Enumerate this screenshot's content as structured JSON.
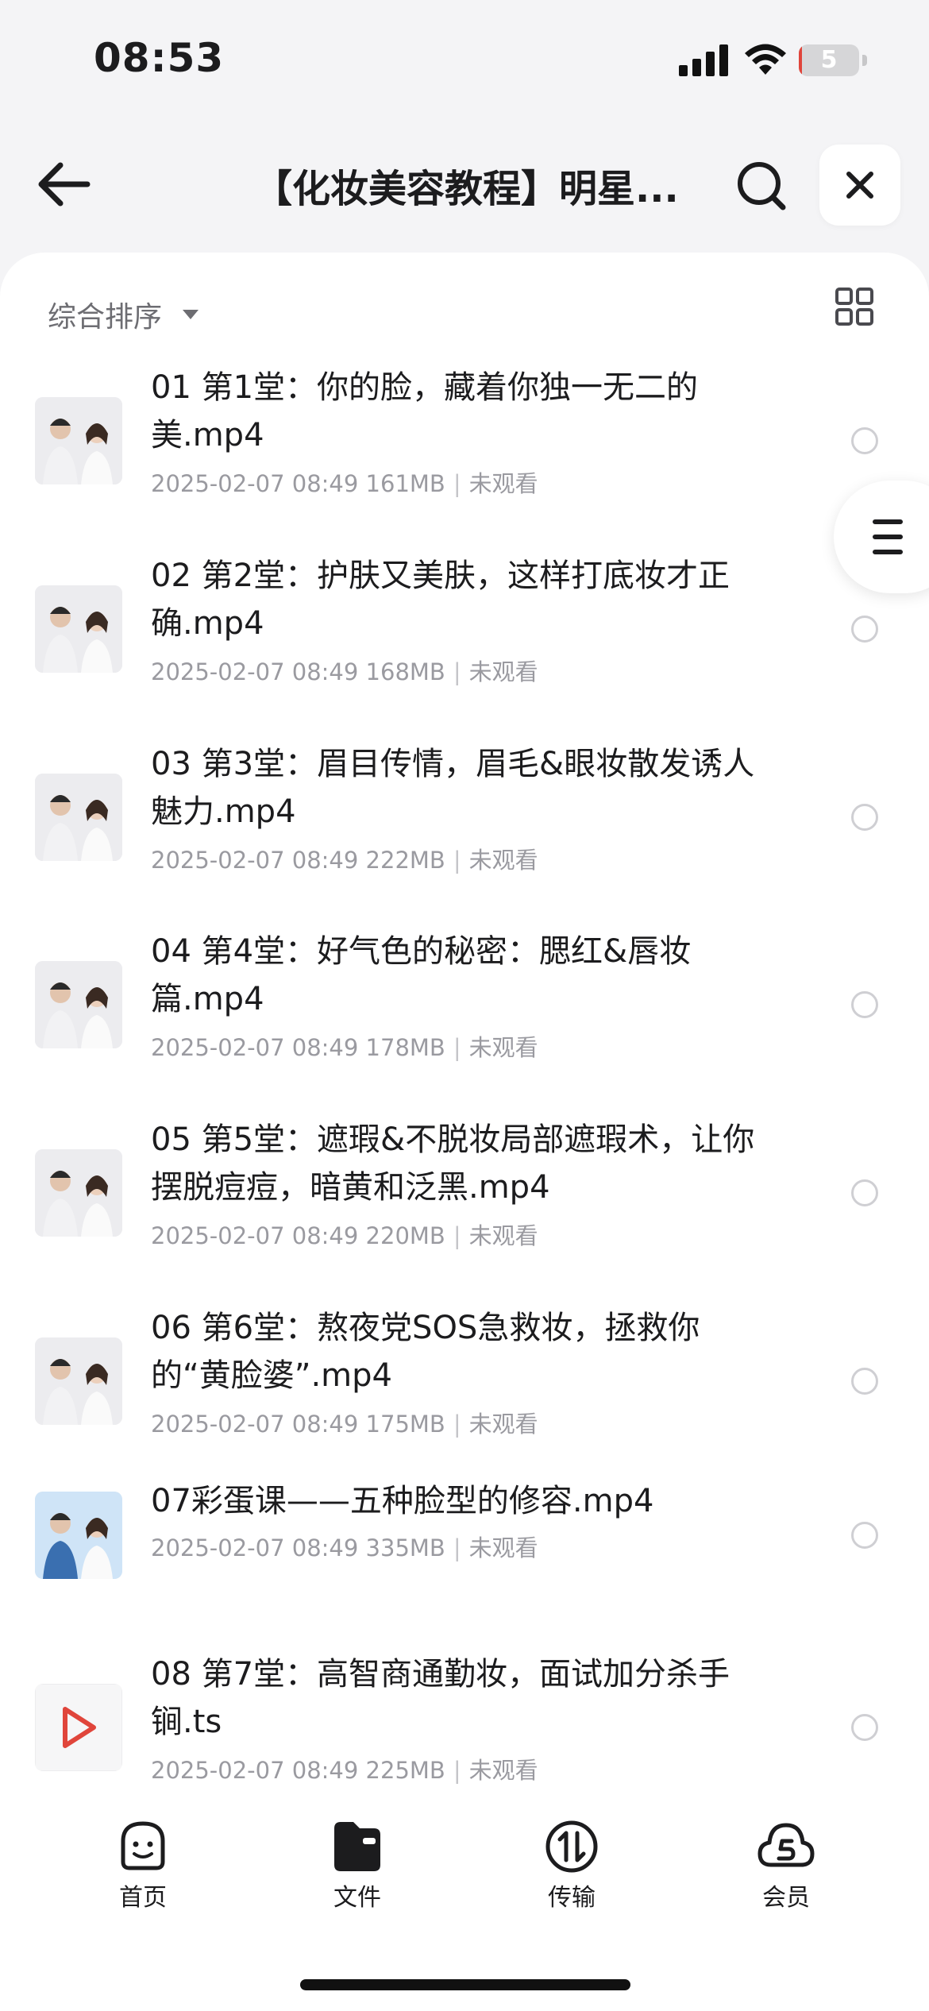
{
  "status_bar": {
    "time": "08:53",
    "battery_level": "5",
    "battery_percent": 5
  },
  "nav": {
    "title": "【化妆美容教程】明星..."
  },
  "toolbar": {
    "sort_label": "综合排序"
  },
  "files": [
    {
      "name": "01 第1堂：你的脸，藏着你独一无二的美.mp4",
      "date": "2025-02-07 08:49",
      "size": "161MB",
      "status": "未观看",
      "thumb": "video"
    },
    {
      "name": "02 第2堂：护肤又美肤，这样打底妆才正确.mp4",
      "date": "2025-02-07 08:49",
      "size": "168MB",
      "status": "未观看",
      "thumb": "video"
    },
    {
      "name": "03 第3堂：眉目传情，眉毛&眼妆散发诱人魅力.mp4",
      "date": "2025-02-07 08:49",
      "size": "222MB",
      "status": "未观看",
      "thumb": "video"
    },
    {
      "name": "04 第4堂：好气色的秘密：腮红&唇妆篇.mp4",
      "date": "2025-02-07 08:49",
      "size": "178MB",
      "status": "未观看",
      "thumb": "video"
    },
    {
      "name": "05 第5堂：遮瑕&不脱妆局部遮瑕术，让你摆脱痘痘，暗黄和泛黑.mp4",
      "date": "2025-02-07 08:49",
      "size": "220MB",
      "status": "未观看",
      "thumb": "video"
    },
    {
      "name": "06 第6堂：熬夜党SOS急救妆，拯救你的“黄脸婆”.mp4",
      "date": "2025-02-07 08:49",
      "size": "175MB",
      "status": "未观看",
      "thumb": "video"
    },
    {
      "name": "07彩蛋课——五种脸型的修容.mp4",
      "date": "2025-02-07 08:49",
      "size": "335MB",
      "status": "未观看",
      "thumb": "video-blue"
    },
    {
      "name": "08 第7堂：高智商通勤妆，面试加分杀手锏.ts",
      "date": "2025-02-07 08:49",
      "size": "225MB",
      "status": "未观看",
      "thumb": "play-file"
    }
  ],
  "tabbar": [
    {
      "label": "首页",
      "icon": "smiley-icon"
    },
    {
      "label": "文件",
      "icon": "folder-icon"
    },
    {
      "label": "传输",
      "icon": "transfer-icon"
    },
    {
      "label": "会员",
      "icon": "cloud-s-icon"
    }
  ],
  "colors": {
    "accent": "#e0453b",
    "text": "#1c1c1e",
    "meta": "#9a9aa0"
  }
}
